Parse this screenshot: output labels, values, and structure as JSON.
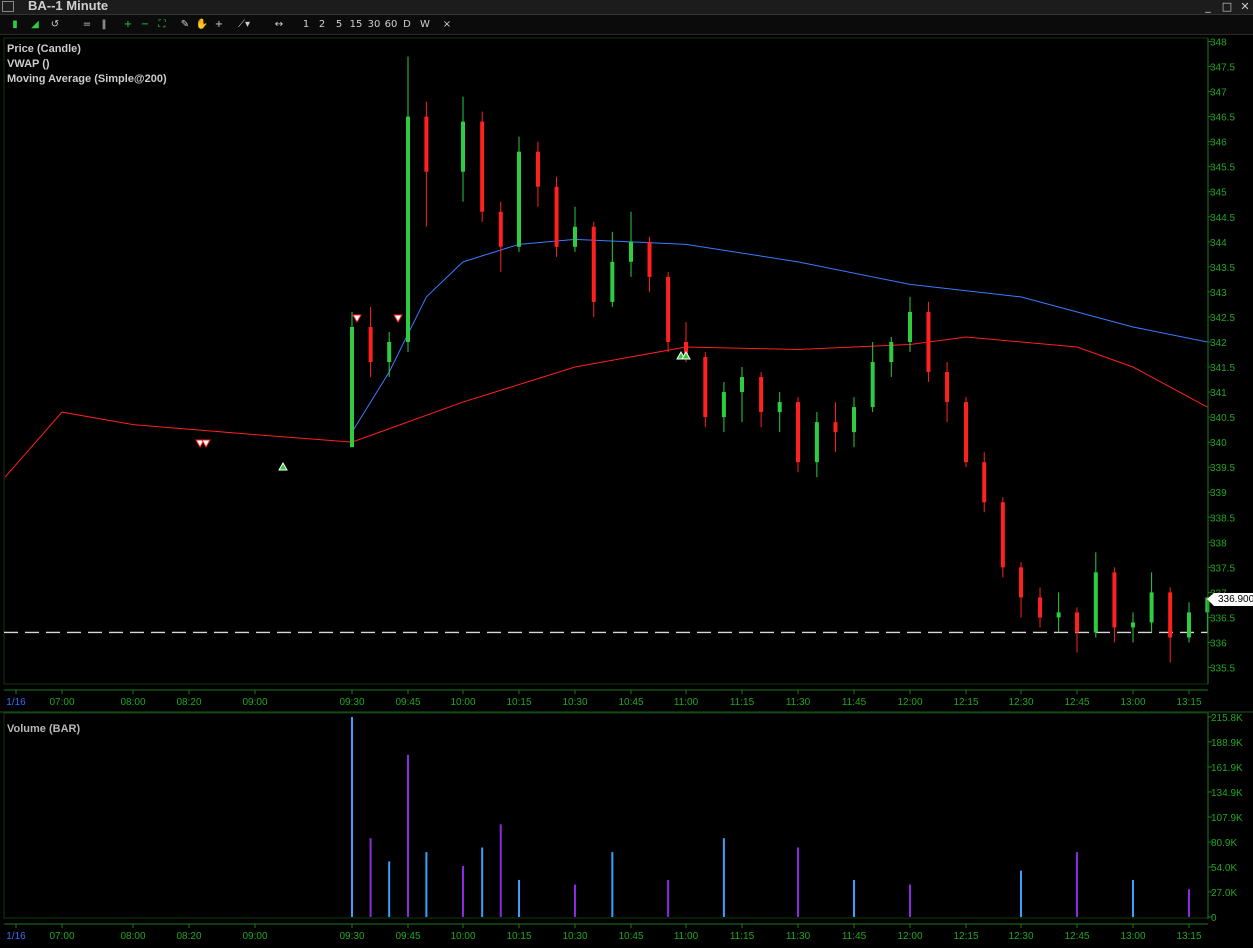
{
  "window": {
    "title": "BA--1 Minute",
    "controls": [
      "_",
      "□",
      "✕"
    ]
  },
  "toolbar": {
    "timeframes": [
      "1",
      "2",
      "5",
      "15",
      "30",
      "60",
      "D",
      "W"
    ],
    "close_label": "×"
  },
  "chart_data": [
    {
      "type": "candlestick",
      "legend": [
        {
          "name": "Price (Candle)",
          "color": "#1e3cff"
        },
        {
          "name": "VWAP ()",
          "color": "#3a7bff"
        },
        {
          "name": "Moving Average (Simple@200)",
          "color": "#ff2020"
        }
      ],
      "y_ticks": [
        "348",
        "347.5",
        "347",
        "346.5",
        "346",
        "345.5",
        "345",
        "344.5",
        "344",
        "343.5",
        "343",
        "342.5",
        "342",
        "341.5",
        "341",
        "340.5",
        "340",
        "339.5",
        "339",
        "338.5",
        "338",
        "337.5",
        "337",
        "336.5",
        "336",
        "335.5"
      ],
      "ylim": [
        335.5,
        348
      ],
      "x_ticks": [
        "1/16",
        "07:00",
        "08:00",
        "08:20",
        "09:00",
        "09:30",
        "09:45",
        "10:00",
        "10:15",
        "10:30",
        "10:45",
        "11:00",
        "11:15",
        "11:30",
        "11:45",
        "12:00",
        "12:15",
        "12:30",
        "12:45",
        "13:00",
        "13:15"
      ],
      "last_price": "336.900",
      "horizontal_line": 336.2,
      "candles": [
        {
          "t": "09:30",
          "o": 339.9,
          "h": 342.6,
          "l": 339.9,
          "c": 342.3
        },
        {
          "t": "09:35",
          "o": 342.3,
          "h": 342.7,
          "l": 341.3,
          "c": 341.6
        },
        {
          "t": "09:40",
          "o": 341.6,
          "h": 342.2,
          "l": 341.3,
          "c": 342.0
        },
        {
          "t": "09:45",
          "o": 342.0,
          "h": 347.7,
          "l": 341.8,
          "c": 346.5
        },
        {
          "t": "09:50",
          "o": 346.5,
          "h": 346.8,
          "l": 344.3,
          "c": 345.4
        },
        {
          "t": "10:00",
          "o": 345.4,
          "h": 346.9,
          "l": 344.8,
          "c": 346.4
        },
        {
          "t": "10:05",
          "o": 346.4,
          "h": 346.6,
          "l": 344.4,
          "c": 344.6
        },
        {
          "t": "10:10",
          "o": 344.6,
          "h": 344.8,
          "l": 343.4,
          "c": 343.9
        },
        {
          "t": "10:15",
          "o": 343.9,
          "h": 346.1,
          "l": 343.8,
          "c": 345.8
        },
        {
          "t": "10:20",
          "o": 345.8,
          "h": 346.0,
          "l": 344.7,
          "c": 345.1
        },
        {
          "t": "10:25",
          "o": 345.1,
          "h": 345.3,
          "l": 343.7,
          "c": 343.9
        },
        {
          "t": "10:30",
          "o": 343.9,
          "h": 344.7,
          "l": 343.8,
          "c": 344.3
        },
        {
          "t": "10:35",
          "o": 344.3,
          "h": 344.4,
          "l": 342.5,
          "c": 342.8
        },
        {
          "t": "10:40",
          "o": 342.8,
          "h": 344.2,
          "l": 342.7,
          "c": 343.6
        },
        {
          "t": "10:45",
          "o": 343.6,
          "h": 344.6,
          "l": 343.3,
          "c": 344.0
        },
        {
          "t": "10:50",
          "o": 344.0,
          "h": 344.1,
          "l": 343.0,
          "c": 343.3
        },
        {
          "t": "10:55",
          "o": 343.3,
          "h": 343.4,
          "l": 341.8,
          "c": 342.0
        },
        {
          "t": "11:00",
          "o": 342.0,
          "h": 342.4,
          "l": 341.6,
          "c": 341.7
        },
        {
          "t": "11:05",
          "o": 341.7,
          "h": 341.8,
          "l": 340.3,
          "c": 340.5
        },
        {
          "t": "11:10",
          "o": 340.5,
          "h": 341.2,
          "l": 340.2,
          "c": 341.0
        },
        {
          "t": "11:15",
          "o": 341.0,
          "h": 341.5,
          "l": 340.4,
          "c": 341.3
        },
        {
          "t": "11:20",
          "o": 341.3,
          "h": 341.4,
          "l": 340.3,
          "c": 340.6
        },
        {
          "t": "11:25",
          "o": 340.6,
          "h": 341.0,
          "l": 340.2,
          "c": 340.8
        },
        {
          "t": "11:30",
          "o": 340.8,
          "h": 340.9,
          "l": 339.4,
          "c": 339.6
        },
        {
          "t": "11:35",
          "o": 339.6,
          "h": 340.6,
          "l": 339.3,
          "c": 340.4
        },
        {
          "t": "11:40",
          "o": 340.4,
          "h": 340.8,
          "l": 339.8,
          "c": 340.2
        },
        {
          "t": "11:45",
          "o": 340.2,
          "h": 340.9,
          "l": 339.9,
          "c": 340.7
        },
        {
          "t": "11:50",
          "o": 340.7,
          "h": 342.0,
          "l": 340.6,
          "c": 341.6
        },
        {
          "t": "11:55",
          "o": 341.6,
          "h": 342.1,
          "l": 341.3,
          "c": 342.0
        },
        {
          "t": "12:00",
          "o": 342.0,
          "h": 342.9,
          "l": 341.8,
          "c": 342.6
        },
        {
          "t": "12:05",
          "o": 342.6,
          "h": 342.8,
          "l": 341.2,
          "c": 341.4
        },
        {
          "t": "12:10",
          "o": 341.4,
          "h": 341.6,
          "l": 340.4,
          "c": 340.8
        },
        {
          "t": "12:15",
          "o": 340.8,
          "h": 340.9,
          "l": 339.5,
          "c": 339.6
        },
        {
          "t": "12:20",
          "o": 339.6,
          "h": 339.8,
          "l": 338.6,
          "c": 338.8
        },
        {
          "t": "12:25",
          "o": 338.8,
          "h": 338.9,
          "l": 337.3,
          "c": 337.5
        },
        {
          "t": "12:30",
          "o": 337.5,
          "h": 337.6,
          "l": 336.5,
          "c": 336.9
        },
        {
          "t": "12:35",
          "o": 336.9,
          "h": 337.1,
          "l": 336.3,
          "c": 336.5
        },
        {
          "t": "12:40",
          "o": 336.5,
          "h": 337.0,
          "l": 336.2,
          "c": 336.6
        },
        {
          "t": "12:45",
          "o": 336.6,
          "h": 336.7,
          "l": 335.8,
          "c": 336.2
        },
        {
          "t": "12:50",
          "o": 336.2,
          "h": 337.8,
          "l": 336.1,
          "c": 337.4
        },
        {
          "t": "12:55",
          "o": 337.4,
          "h": 337.5,
          "l": 336.0,
          "c": 336.3
        },
        {
          "t": "13:00",
          "o": 336.3,
          "h": 336.6,
          "l": 336.0,
          "c": 336.4
        },
        {
          "t": "13:05",
          "o": 336.4,
          "h": 337.4,
          "l": 336.2,
          "c": 337.0
        },
        {
          "t": "13:10",
          "o": 337.0,
          "h": 337.1,
          "l": 335.6,
          "c": 336.1
        },
        {
          "t": "13:15",
          "o": 336.1,
          "h": 336.8,
          "l": 336.0,
          "c": 336.6
        },
        {
          "t": "13:20",
          "o": 336.6,
          "h": 336.9,
          "l": 336.2,
          "c": 336.9
        }
      ],
      "vwap": [
        {
          "t": "09:30",
          "v": 340.2
        },
        {
          "t": "09:40",
          "v": 341.4
        },
        {
          "t": "09:50",
          "v": 342.9
        },
        {
          "t": "10:00",
          "v": 343.6
        },
        {
          "t": "10:15",
          "v": 343.95
        },
        {
          "t": "10:30",
          "v": 344.05
        },
        {
          "t": "11:00",
          "v": 343.95
        },
        {
          "t": "11:30",
          "v": 343.6
        },
        {
          "t": "12:00",
          "v": 343.15
        },
        {
          "t": "12:30",
          "v": 342.9
        },
        {
          "t": "13:00",
          "v": 342.3
        },
        {
          "t": "13:20",
          "v": 342.0
        }
      ],
      "moving_average": [
        {
          "t": "pre",
          "v": 339.3
        },
        {
          "t": "07:00",
          "v": 340.6
        },
        {
          "t": "08:00",
          "v": 340.35
        },
        {
          "t": "09:00",
          "v": 340.15
        },
        {
          "t": "09:30",
          "v": 340.0
        },
        {
          "t": "10:00",
          "v": 340.8
        },
        {
          "t": "10:30",
          "v": 341.5
        },
        {
          "t": "11:00",
          "v": 341.9
        },
        {
          "t": "11:30",
          "v": 341.85
        },
        {
          "t": "12:00",
          "v": 341.95
        },
        {
          "t": "12:15",
          "v": 342.1
        },
        {
          "t": "12:45",
          "v": 341.9
        },
        {
          "t": "13:00",
          "v": 341.5
        },
        {
          "t": "13:20",
          "v": 340.7
        }
      ]
    },
    {
      "type": "bar",
      "title": "Volume (BAR)",
      "y_ticks": [
        "215.8K",
        "188.9K",
        "161.9K",
        "134.9K",
        "107.9K",
        "80.9K",
        "54.0K",
        "27.0K",
        "0"
      ],
      "ylim": [
        0,
        215.8
      ],
      "x_ticks": [
        "1/16",
        "07:00",
        "08:00",
        "08:20",
        "09:00",
        "09:30",
        "09:45",
        "10:00",
        "10:15",
        "10:30",
        "10:45",
        "11:00",
        "11:15",
        "11:30",
        "11:45",
        "12:00",
        "12:15",
        "12:30",
        "12:45",
        "13:00",
        "13:15"
      ],
      "series": [
        {
          "t": "09:30",
          "v": 215.8
        },
        {
          "t": "09:35",
          "v": 85.0
        },
        {
          "t": "09:40",
          "v": 60.0
        },
        {
          "t": "09:45",
          "v": 175.0
        },
        {
          "t": "09:50",
          "v": 70.0
        },
        {
          "t": "10:00",
          "v": 55.0
        },
        {
          "t": "10:05",
          "v": 75.0
        },
        {
          "t": "10:10",
          "v": 100.0
        },
        {
          "t": "10:15",
          "v": 40.0
        },
        {
          "t": "10:30",
          "v": 35.0
        },
        {
          "t": "10:40",
          "v": 70.0
        },
        {
          "t": "10:55",
          "v": 40.0
        },
        {
          "t": "11:10",
          "v": 85.0
        },
        {
          "t": "11:30",
          "v": 75.0
        },
        {
          "t": "11:45",
          "v": 40.0
        },
        {
          "t": "12:00",
          "v": 35.0
        },
        {
          "t": "12:30",
          "v": 50.0
        },
        {
          "t": "12:45",
          "v": 70.0
        },
        {
          "t": "13:00",
          "v": 40.0
        },
        {
          "t": "13:15",
          "v": 30.0
        }
      ]
    }
  ]
}
